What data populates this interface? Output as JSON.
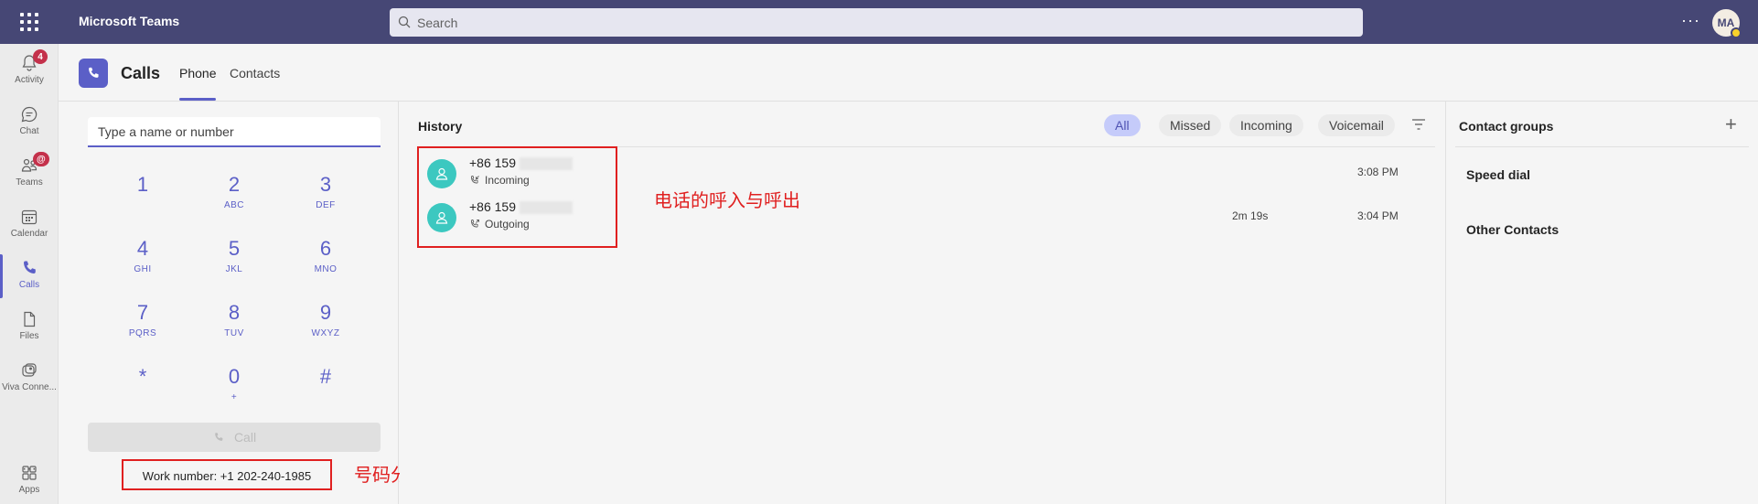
{
  "topbar": {
    "app_title": "Microsoft Teams",
    "search_placeholder": "Search",
    "more_label": "···",
    "avatar_initials": "MA"
  },
  "rail": {
    "items": [
      {
        "label": "Activity",
        "icon": "bell-icon",
        "badge": "4"
      },
      {
        "label": "Chat",
        "icon": "chat-icon"
      },
      {
        "label": "Teams",
        "icon": "teams-icon",
        "badge": "@"
      },
      {
        "label": "Calendar",
        "icon": "calendar-icon"
      },
      {
        "label": "Calls",
        "icon": "phone-icon",
        "active": true
      },
      {
        "label": "Files",
        "icon": "file-icon"
      },
      {
        "label": "Viva Conne...",
        "icon": "viva-icon"
      },
      {
        "label": "Apps",
        "icon": "apps-icon"
      }
    ],
    "more_label": "···"
  },
  "header": {
    "title": "Calls",
    "tabs": [
      {
        "label": "Phone",
        "active": true
      },
      {
        "label": "Contacts",
        "active": false
      }
    ]
  },
  "dialpad": {
    "input_placeholder": "Type a name or number",
    "keys": [
      {
        "digit": "1",
        "letters": ""
      },
      {
        "digit": "2",
        "letters": "ABC"
      },
      {
        "digit": "3",
        "letters": "DEF"
      },
      {
        "digit": "4",
        "letters": "GHI"
      },
      {
        "digit": "5",
        "letters": "JKL"
      },
      {
        "digit": "6",
        "letters": "MNO"
      },
      {
        "digit": "7",
        "letters": "PQRS"
      },
      {
        "digit": "8",
        "letters": "TUV"
      },
      {
        "digit": "9",
        "letters": "WXYZ"
      },
      {
        "digit": "*",
        "letters": ""
      },
      {
        "digit": "0",
        "letters": "+"
      },
      {
        "digit": "#",
        "letters": ""
      }
    ],
    "call_label": "Call",
    "work_number": "Work number: +1 202-240-1985"
  },
  "annotations": {
    "number_assignment": "号码分配",
    "calls_in_out": "电话的呼入与呼出"
  },
  "history": {
    "title": "History",
    "filters": [
      {
        "label": "All",
        "active": true
      },
      {
        "label": "Missed",
        "active": false
      },
      {
        "label": "Incoming",
        "active": false
      },
      {
        "label": "Voicemail",
        "active": false
      }
    ],
    "rows": [
      {
        "number": "+86 159",
        "direction": "Incoming",
        "duration": "",
        "time": "3:08 PM"
      },
      {
        "number": "+86 159",
        "direction": "Outgoing",
        "duration": "2m 19s",
        "time": "3:04 PM"
      }
    ]
  },
  "contact_groups": {
    "title": "Contact groups",
    "add_label": "+",
    "items": [
      "Speed dial",
      "Other Contacts"
    ]
  },
  "colors": {
    "topbar": "#464775",
    "accent": "#5b5fc7",
    "annotation_red": "#e02020",
    "person_avatar": "#3cc8c0"
  }
}
